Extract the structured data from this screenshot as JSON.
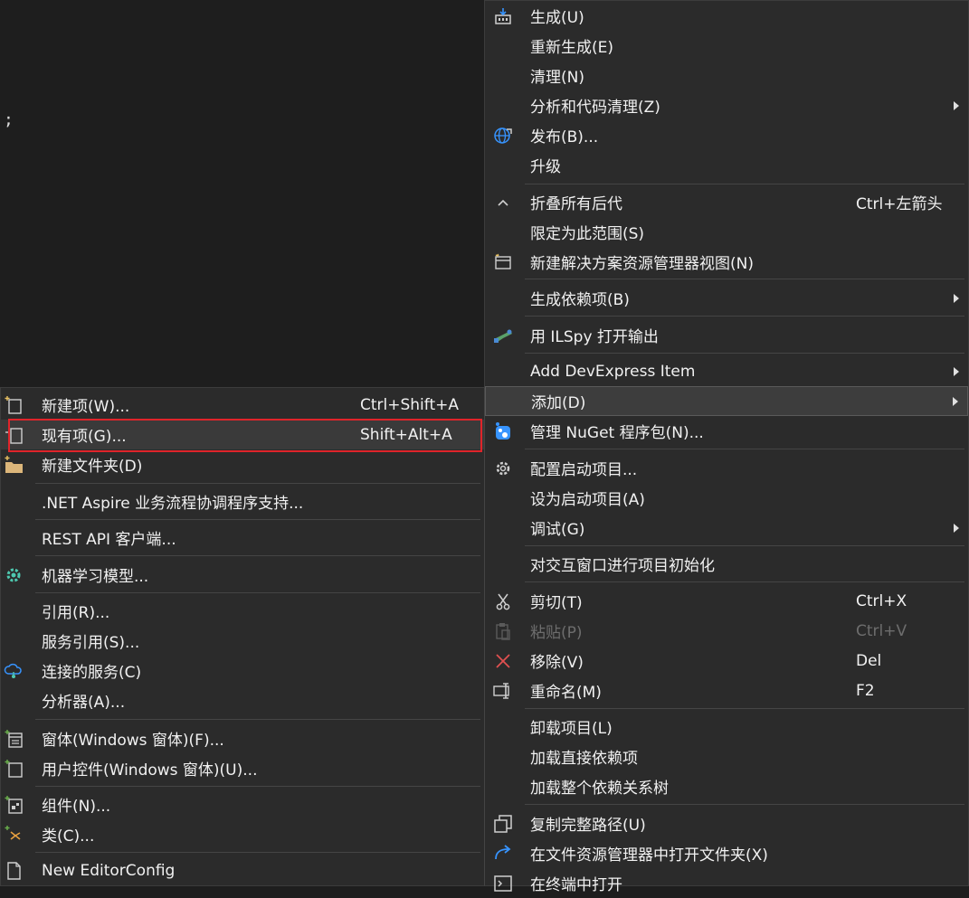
{
  "editor": {
    "code_fragment": ";"
  },
  "main_menu": {
    "items": [
      {
        "label": "生成(U)",
        "icon": "build-icon"
      },
      {
        "label": "重新生成(E)"
      },
      {
        "label": "清理(N)"
      },
      {
        "label": "分析和代码清理(Z)",
        "submenu": true
      },
      {
        "label": "发布(B)...",
        "icon": "globe-publish-icon"
      },
      {
        "label": "升级"
      },
      {
        "label": "折叠所有后代",
        "shortcut": "Ctrl+左箭头",
        "icon": "collapse-caret-icon"
      },
      {
        "label": "限定为此范围(S)"
      },
      {
        "label": "新建解决方案资源管理器视图(N)",
        "icon": "new-view-icon"
      },
      {
        "label": "生成依赖项(B)",
        "submenu": true
      },
      {
        "label": "用 ILSpy 打开输出",
        "icon": "ilspy-icon"
      },
      {
        "label": "Add DevExpress Item",
        "submenu": true
      },
      {
        "label": "添加(D)",
        "submenu": true
      },
      {
        "label": "管理 NuGet 程序包(N)...",
        "icon": "nuget-icon"
      },
      {
        "label": "配置启动项目...",
        "icon": "gear-icon"
      },
      {
        "label": "设为启动项目(A)"
      },
      {
        "label": "调试(G)",
        "submenu": true
      },
      {
        "label": "对交互窗口进行项目初始化"
      },
      {
        "label": "剪切(T)",
        "shortcut": "Ctrl+X",
        "icon": "scissors-icon"
      },
      {
        "label": "粘贴(P)",
        "shortcut": "Ctrl+V",
        "icon": "paste-icon",
        "disabled": true
      },
      {
        "label": "移除(V)",
        "shortcut": "Del",
        "icon": "remove-x-icon"
      },
      {
        "label": "重命名(M)",
        "shortcut": "F2",
        "icon": "rename-icon"
      },
      {
        "label": "卸载项目(L)"
      },
      {
        "label": "加载直接依赖项"
      },
      {
        "label": "加载整个依赖关系树"
      },
      {
        "label": "复制完整路径(U)",
        "icon": "copy-path-icon"
      },
      {
        "label": "在文件资源管理器中打开文件夹(X)",
        "icon": "open-folder-arrow-icon"
      },
      {
        "label": "在终端中打开",
        "icon": "terminal-icon"
      }
    ]
  },
  "sub_menu": {
    "items": [
      {
        "label": "新建项(W)...",
        "shortcut": "Ctrl+Shift+A",
        "icon": "new-item-icon"
      },
      {
        "label": "现有项(G)...",
        "shortcut": "Shift+Alt+A",
        "icon": "existing-item-icon"
      },
      {
        "label": "新建文件夹(D)",
        "icon": "new-folder-icon"
      },
      {
        "label": ".NET Aspire 业务流程协调程序支持..."
      },
      {
        "label": "REST API 客户端..."
      },
      {
        "label": "机器学习模型...",
        "icon": "ml-model-icon"
      },
      {
        "label": "引用(R)..."
      },
      {
        "label": "服务引用(S)..."
      },
      {
        "label": "连接的服务(C)",
        "icon": "connected-service-icon"
      },
      {
        "label": "分析器(A)..."
      },
      {
        "label": "窗体(Windows 窗体)(F)...",
        "icon": "windows-form-icon"
      },
      {
        "label": "用户控件(Windows 窗体)(U)...",
        "icon": "user-control-icon"
      },
      {
        "label": "组件(N)...",
        "icon": "component-icon"
      },
      {
        "label": "类(C)...",
        "icon": "class-icon"
      },
      {
        "label": "New EditorConfig",
        "icon": "editorconfig-file-icon"
      }
    ]
  },
  "colors": {
    "menu_bg": "#2b2b2b",
    "highlight_border": "#e0242a",
    "accent_blue": "#3794ff",
    "disabled_text": "#6d6d6d"
  }
}
